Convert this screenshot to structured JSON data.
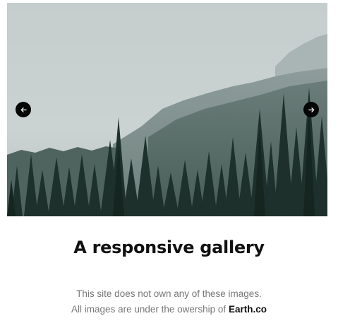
{
  "gallery": {
    "image_alt": "Misty pine forest below mountain slopes",
    "prev_icon": "arrow-left-icon",
    "next_icon": "arrow-right-icon"
  },
  "heading": "A responsive gallery",
  "notice": {
    "line1": "This site does not own any of these images.",
    "line2_prefix": "All images are under the owership of",
    "brand": "Earth.co"
  },
  "colors": {
    "sky": "#c9d0d0",
    "forest": "#1d302b",
    "button": "#050505",
    "heading": "#111111",
    "muted_text": "#777777"
  }
}
